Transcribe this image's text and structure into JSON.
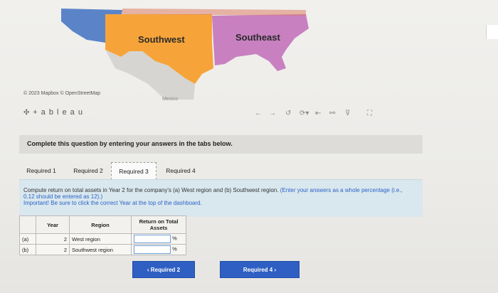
{
  "map": {
    "regions": [
      {
        "name": "Southwest",
        "color": "#f6a43a"
      },
      {
        "name": "Southeast",
        "color": "#c880c0"
      }
    ],
    "west_color": "#5b84c8",
    "mexico_label": "Mexico",
    "copyright": "© 2023 Mapbox  © OpenStreetMap"
  },
  "tableau": {
    "logo_text": "+ a b l e a u",
    "toolbar_icons": [
      "undo-icon",
      "redo-icon",
      "revert-icon",
      "refresh-icon",
      "pause-icon",
      "share-icon",
      "comment-icon",
      "fullscreen-icon"
    ]
  },
  "instruction": "Complete this question by entering your answers in the tabs below.",
  "tabs": [
    {
      "label": "Required 1",
      "active": false
    },
    {
      "label": "Required 2",
      "active": false
    },
    {
      "label": "Required 3",
      "active": true
    },
    {
      "label": "Required 4",
      "active": false
    }
  ],
  "question": {
    "main": "Compute return on total assets in Year 2 for the company's (a) West region and (b) Southwest region.",
    "hint": "(Enter your answers as a whole percentage (i.e., 0.12 should be entered as 12).)",
    "important": "Important! Be sure to click the correct Year at the top of the dashboard."
  },
  "table": {
    "headers": [
      "Year",
      "Region",
      "Return on Total Assets"
    ],
    "rows": [
      {
        "label": "(a)",
        "year": "2",
        "region": "West region",
        "value": "",
        "unit": "%"
      },
      {
        "label": "(b)",
        "year": "2",
        "region": "Southwest region",
        "value": "",
        "unit": "%"
      }
    ]
  },
  "buttons": {
    "prev": "‹  Required 2",
    "next": "Required 4  ›"
  }
}
